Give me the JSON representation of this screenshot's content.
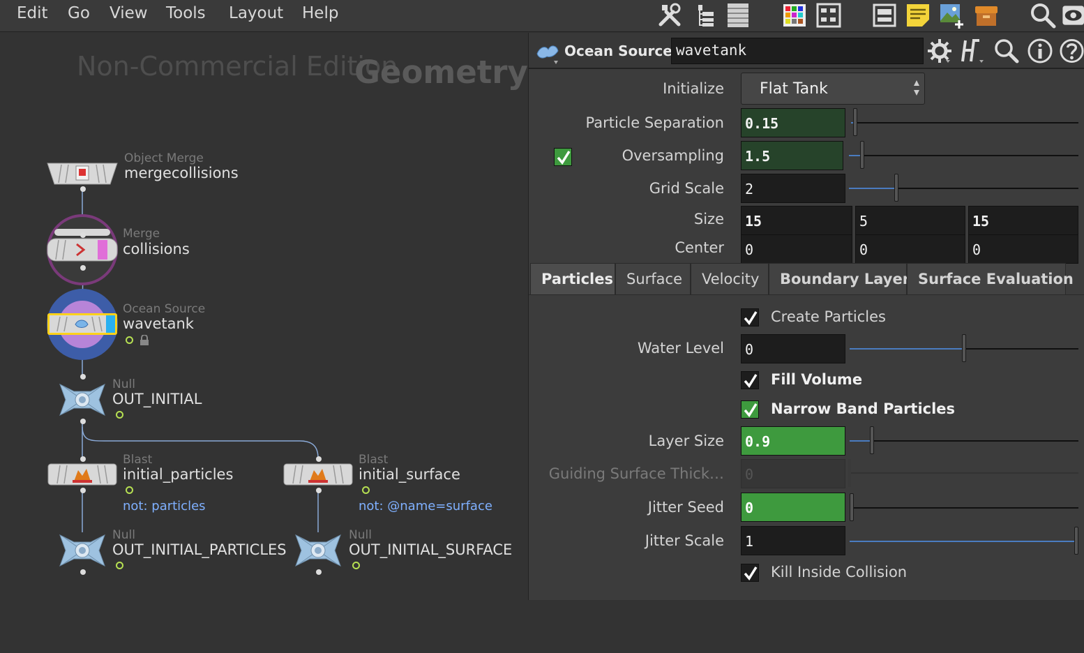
{
  "menubar": {
    "items": [
      "Edit",
      "Go",
      "View",
      "Tools",
      "Layout",
      "Help"
    ]
  },
  "network": {
    "watermark": "Non-Commercial Edition",
    "context_label": "Geometry",
    "nodes": {
      "mergecollisions": {
        "type": "Object Merge",
        "name": "mergecollisions"
      },
      "collisions": {
        "type": "Merge",
        "name": "collisions"
      },
      "wavetank": {
        "type": "Ocean Source",
        "name": "wavetank"
      },
      "out_initial": {
        "type": "Null",
        "name": "OUT_INITIAL"
      },
      "initial_particles": {
        "type": "Blast",
        "name": "initial_particles",
        "comment": "not: particles"
      },
      "initial_surface": {
        "type": "Blast",
        "name": "initial_surface",
        "comment": "not: @name=surface"
      },
      "out_initial_particles": {
        "type": "Null",
        "name": "OUT_INITIAL_PARTICLES"
      },
      "out_initial_surface": {
        "type": "Null",
        "name": "OUT_INITIAL_SURFACE"
      }
    }
  },
  "params": {
    "header": {
      "node_type": "Ocean Source",
      "node_name": "wavetank"
    },
    "initialize": {
      "label": "Initialize",
      "value": "Flat Tank"
    },
    "particle_separation": {
      "label": "Particle Separation",
      "value": "0.15",
      "slider": 0.01
    },
    "oversampling": {
      "label": "Oversampling",
      "value": "1.5",
      "slider": 0.05,
      "enabled": true
    },
    "grid_scale": {
      "label": "Grid Scale",
      "value": "2",
      "slider": 0.2
    },
    "size": {
      "label": "Size",
      "values": [
        "15",
        "5",
        "15"
      ]
    },
    "center": {
      "label": "Center",
      "values": [
        "0",
        "0",
        "0"
      ]
    },
    "tabs": [
      "Particles",
      "Surface",
      "Velocity",
      "Boundary Layer",
      "Surface Evaluation"
    ],
    "create_particles": {
      "label": "Create Particles",
      "checked": true
    },
    "water_level": {
      "label": "Water Level",
      "value": "0",
      "slider": 0.5
    },
    "fill_volume": {
      "label": "Fill Volume",
      "checked": true
    },
    "narrow_band": {
      "label": "Narrow Band Particles",
      "checked": true
    },
    "layer_size": {
      "label": "Layer Size",
      "value": "0.9",
      "slider": 0.09
    },
    "guiding_thickness": {
      "label": "Guiding Surface Thick…",
      "value": "0"
    },
    "jitter_seed": {
      "label": "Jitter Seed",
      "value": "0",
      "slider": 0.0
    },
    "jitter_scale": {
      "label": "Jitter Scale",
      "value": "1",
      "slider": 1.0
    },
    "kill_inside": {
      "label": "Kill Inside Collision",
      "checked": true
    }
  },
  "colors": {
    "background": "#333333",
    "param_bg": "#3c3c3c",
    "keyframe_green": "#3e9a3e",
    "animated_green": "#26432a",
    "slider_blue": "#4a7cc0",
    "selected_outline": "#ffd21a",
    "comment_blue": "#7fb0ff",
    "flag_green": "#b6e052"
  },
  "icons": [
    "tools-icon",
    "tree-icon",
    "list-icon",
    "color-palette-icon",
    "grid-icon",
    "layout-icon",
    "sticky-note-icon",
    "image-add-icon",
    "box-icon",
    "search-icon",
    "eye-icon",
    "gear-icon",
    "houdini-help-icon",
    "magnifier-icon",
    "info-icon",
    "help-icon"
  ]
}
